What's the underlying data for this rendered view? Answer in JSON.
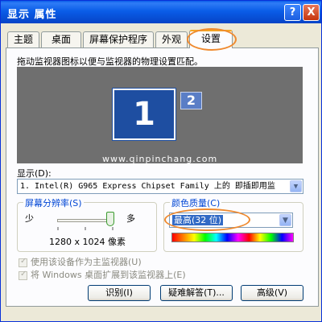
{
  "window": {
    "title": "显示 属性"
  },
  "titlebar": {
    "help_label": "?",
    "close_label": "X"
  },
  "tabs": [
    {
      "label": "主题"
    },
    {
      "label": "桌面"
    },
    {
      "label": "屏幕保护程序"
    },
    {
      "label": "外观"
    },
    {
      "label": "设置",
      "active": true
    }
  ],
  "settings": {
    "description": "拖动监视器图标以便与监视器的物理设置匹配。",
    "monitors": [
      {
        "label": "1"
      },
      {
        "label": "2"
      }
    ],
    "watermark": "www.qinpinchang.com",
    "display_label": "显示(D):",
    "display_value": "1. Intel(R)  G965 Express Chipset Family 上的 即插即用监",
    "resolution": {
      "title": "屏幕分辨率(S)",
      "less_label": "少",
      "more_label": "多",
      "value": "1280 x 1024 像素",
      "slider_position": 1.0
    },
    "color_quality": {
      "title": "颜色质量(C)",
      "selected": "最高(32 位)"
    },
    "checkboxes": [
      {
        "label": "使用该设备作为主监视器(U)",
        "checked": true,
        "disabled": true
      },
      {
        "label": "将 Windows 桌面扩展到该监视器上(E)",
        "checked": true,
        "disabled": true
      }
    ],
    "buttons": {
      "identify": "识别(I)",
      "troubleshoot": "疑难解答(T)...",
      "advanced": "高级(V)"
    }
  },
  "colors": {
    "highlight_ring": "#ef8a2f",
    "titlebar": "#0a5de8",
    "group_title": "#0046d5",
    "selection": "#316ac5"
  }
}
